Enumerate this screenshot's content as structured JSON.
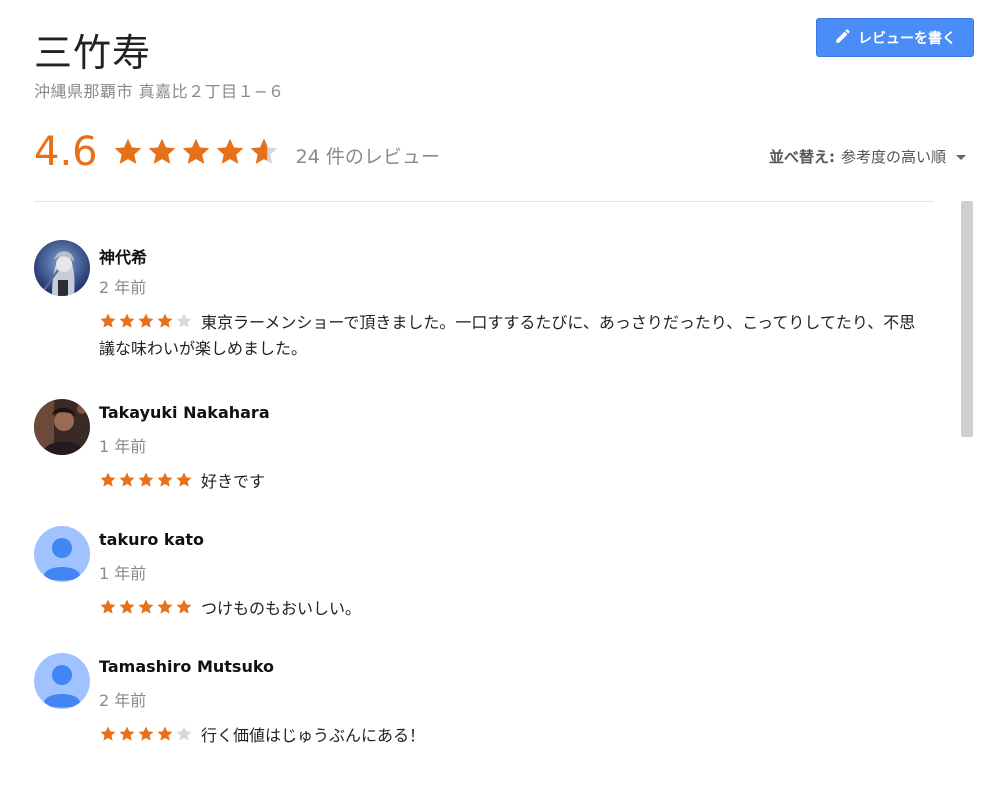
{
  "place": {
    "title": "三竹寿",
    "address": "沖縄県那覇市 真嘉比２丁目１−６",
    "rating": "4.6",
    "rating_fraction": 0.92,
    "review_count": "24 件のレビュー"
  },
  "actions": {
    "write_review_label": "レビューを書く",
    "write_review_icon": "pencil-icon"
  },
  "sort": {
    "label": "並べ替え:",
    "value": "参考度の高い順"
  },
  "colors": {
    "accent": "#e7711b",
    "button": "#4b8df8",
    "muted": "#8a8a8a",
    "empty_star": "#d8d8d8"
  },
  "reviews": [
    {
      "name": "神代希",
      "date": "2 年前",
      "stars": 4,
      "text": "東京ラーメンショーで頂きました。一口すするたびに、あっさりだったり、こってりしてたり、不思議な味わいが楽しめました。",
      "avatar": "anime-character-avatar"
    },
    {
      "name": "Takayuki Nakahara",
      "date": "1 年前",
      "stars": 5,
      "text": "好きです",
      "avatar": "photo-avatar"
    },
    {
      "name": "takuro kato",
      "date": "1 年前",
      "stars": 5,
      "text": "つけものもおいしい。",
      "avatar": "default-person-avatar"
    },
    {
      "name": "Tamashiro Mutsuko",
      "date": "2 年前",
      "stars": 4,
      "text": "行く価値はじゅうぶんにある！",
      "avatar": "default-person-avatar"
    }
  ]
}
